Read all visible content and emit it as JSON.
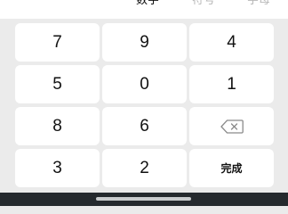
{
  "tabs": [
    {
      "label": "数字",
      "active": true
    },
    {
      "label": "符号",
      "active": false
    },
    {
      "label": "字母",
      "active": false
    }
  ],
  "keys": {
    "r1": [
      "7",
      "9",
      "4"
    ],
    "r2": [
      "5",
      "0",
      "1"
    ],
    "r3": [
      "8",
      "6"
    ],
    "r4": [
      "3",
      "2"
    ],
    "delete_icon": "backspace-icon",
    "done_label": "完成"
  },
  "colors": {
    "keyboard_bg": "#ebebeb",
    "key_bg": "#ffffff",
    "key_text": "#111111",
    "inactive_tab": "#b8b8b8",
    "nav_bar": "#252a2e"
  }
}
